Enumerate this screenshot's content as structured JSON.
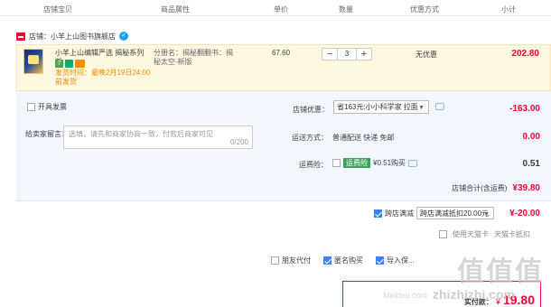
{
  "columns": [
    "店铺宝贝",
    "商品属性",
    "单价",
    "数量",
    "优惠方式",
    "小计"
  ],
  "shop": {
    "name": "店铺：小羊上山图书旗舰店"
  },
  "item": {
    "title": "小羊上山编辑严选 揭秘系列新...",
    "badge_seven": "7",
    "ship_note": "发货时间：最晚2月19日24:00前发货",
    "attrs": "分册名：揭秘翻翻书：揭秘太空-新版",
    "unit_price": "67.60",
    "quantity": "3",
    "minus": "−",
    "plus": "+",
    "discount": "无优惠",
    "subtotal": "202.80"
  },
  "invoice": {
    "label": "开具发票"
  },
  "message": {
    "label": "给卖家留言：",
    "placeholder": "选填，请先和商家协商一致，付款后商家可见",
    "counter": "0/200"
  },
  "shop_discount": {
    "label": "店铺优惠：",
    "selected": "省163元:小小科学家 拉面",
    "amount": "-163.00"
  },
  "shipping": {
    "label": "运送方式：",
    "value": "普通配送 快递 免邮",
    "amount": "0.00"
  },
  "insurance": {
    "label": "运费险：",
    "tag": "运费险",
    "text": "¥0.51购买",
    "amount": "0.51"
  },
  "shop_total": {
    "label": "店铺合计(含运费)",
    "amount": "¥39.80"
  },
  "cross_store": {
    "label": "跨店满减",
    "selected": "跨店满减抵扣20.00元",
    "amount": "¥-20.00"
  },
  "partial_row": {
    "text1": "使用天猫卡",
    "text2": "天猫卡抵扣"
  },
  "options": {
    "friend_pay": "朋友代付",
    "anonymous": "匿名购买",
    "import": "导入保..."
  },
  "pay": {
    "label": "实付款：",
    "currency": "¥",
    "amount": "19.80"
  },
  "watermark": {
    "main": "值值值",
    "site": "Meideu.com",
    "domain": "zhizhizhi.com"
  },
  "colors": {
    "accent_red": "#ff0036",
    "panel_blue": "#f2f7ff",
    "item_yellow": "#fff8e1",
    "check_blue": "#3b82f6"
  }
}
